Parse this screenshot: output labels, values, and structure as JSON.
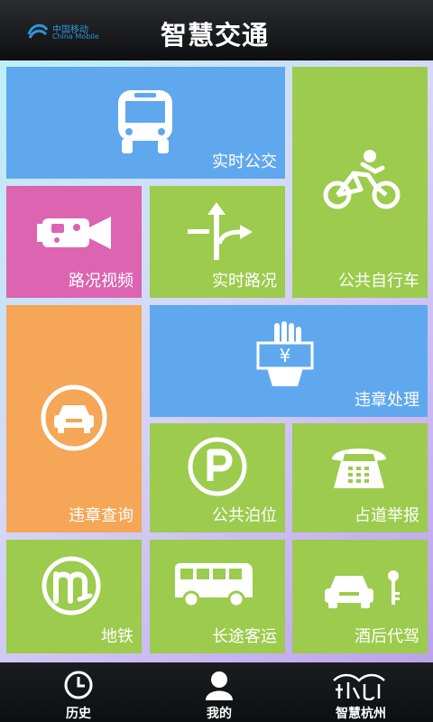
{
  "status": {
    "carrier_cn": "中国移动",
    "carrier_en": "China Mobile"
  },
  "header": {
    "title": "智慧交通"
  },
  "tiles": {
    "realtime_bus": "实时公交",
    "public_bike": "公共自行车",
    "road_video": "路况视频",
    "realtime_traffic": "实时路况",
    "violation_handling": "违章处理",
    "violation_query": "违章查询",
    "public_parking": "公共泊位",
    "road_report": "占道举报",
    "metro": "地铁",
    "long_distance_bus": "长途客运",
    "designated_driver": "酒后代驾",
    "currency_symbol": "¥"
  },
  "tabbar": {
    "history": "历史",
    "mine": "我的",
    "smart_hangzhou": "智慧杭州"
  },
  "colors": {
    "blue": "#5fa8ee",
    "green": "#9ccb4d",
    "pink": "#dc64b1",
    "orange": "#f5a656"
  }
}
